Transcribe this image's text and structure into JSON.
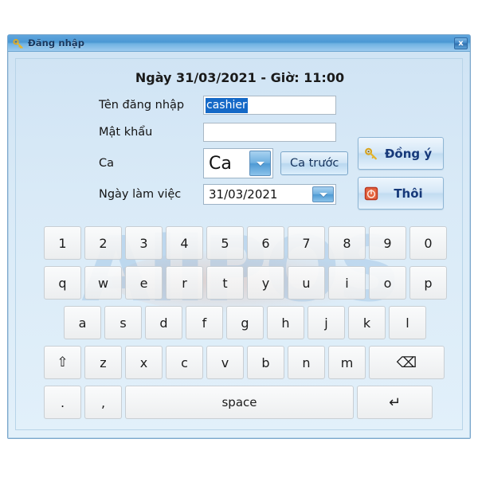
{
  "window": {
    "title": "Đăng nhập",
    "title_icon": "key-icon",
    "close_label": "x",
    "close_icon": "close-icon"
  },
  "header": {
    "date_line": "Ngày 31/03/2021 - Giờ: 11:00"
  },
  "watermark": {
    "part1": "All",
    "part2": "POS"
  },
  "form": {
    "username": {
      "label": "Tên đăng nhập",
      "value": "cashier",
      "placeholder": ""
    },
    "password": {
      "label": "Mật khẩu",
      "value": "",
      "placeholder": ""
    },
    "shift": {
      "label": "Ca",
      "value": "Ca",
      "dropdown_icon": "chevron-down-icon",
      "prev_shift_label": "Ca trước"
    },
    "workdate": {
      "label": "Ngày làm việc",
      "value": "31/03/2021",
      "dropdown_icon": "chevron-down-icon"
    }
  },
  "actions": {
    "ok": {
      "label": "Đồng ý",
      "icon": "key-icon"
    },
    "cancel": {
      "label": "Thôi",
      "icon": "power-off-icon"
    }
  },
  "keyboard": {
    "row1": [
      "1",
      "2",
      "3",
      "4",
      "5",
      "6",
      "7",
      "8",
      "9",
      "0"
    ],
    "row2": [
      "q",
      "w",
      "e",
      "r",
      "t",
      "y",
      "u",
      "i",
      "o",
      "p"
    ],
    "row3": [
      "a",
      "s",
      "d",
      "f",
      "g",
      "h",
      "j",
      "k",
      "l"
    ],
    "row4_shift": "⇧",
    "row4": [
      "z",
      "x",
      "c",
      "v",
      "b",
      "n",
      "m"
    ],
    "row4_backspace": "⌫",
    "row5_dot": ".",
    "row5_comma": ",",
    "row5_space": "space",
    "row5_enter": "↵"
  },
  "colors": {
    "titlebar_blue": "#4b98d4",
    "dialog_bg": "#d9eaf7",
    "selection_blue": "#1569c7",
    "button_text_blue": "#16397a",
    "watermark_blue": "#78aad7",
    "cancel_icon_red": "#d93a2b"
  }
}
